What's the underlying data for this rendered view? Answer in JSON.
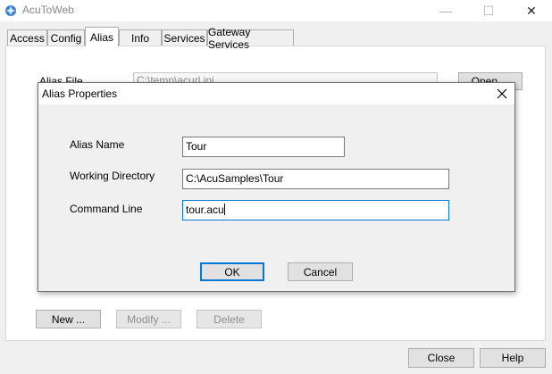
{
  "window": {
    "title": "AcuToWeb",
    "controls": {
      "minimize": "—",
      "maximize": "☐",
      "close": "✕"
    }
  },
  "tabs": [
    {
      "label": "Access",
      "active": false
    },
    {
      "label": "Config",
      "active": false
    },
    {
      "label": "Alias",
      "active": true
    },
    {
      "label": "Info",
      "active": false
    },
    {
      "label": "Services",
      "active": false
    },
    {
      "label": "Gateway Services",
      "active": false
    }
  ],
  "alias_panel": {
    "alias_file_label": "Alias File",
    "alias_file_value": "C:\\temp\\acurl.ini",
    "open_label": "Open ...",
    "new_label": "New ...",
    "modify_label": "Modify ...",
    "delete_label": "Delete"
  },
  "footer": {
    "close_label": "Close",
    "help_label": "Help"
  },
  "dialog": {
    "title": "Alias Properties",
    "close_glyph": "✕",
    "alias_name_label": "Alias Name",
    "alias_name_value": "Tour",
    "working_directory_label": "Working Directory",
    "working_directory_value": "C:\\AcuSamples\\Tour",
    "command_line_label": "Command Line",
    "command_line_value": "tour.acu",
    "ok_label": "OK",
    "cancel_label": "Cancel"
  },
  "colors": {
    "focus_accent": "#0078d7",
    "window_bg": "#f0f0f0",
    "disabled_text": "#8d8d8d"
  },
  "icons": {
    "app_icon": "acutoweb-app-icon",
    "dialog_close": "close-icon"
  }
}
